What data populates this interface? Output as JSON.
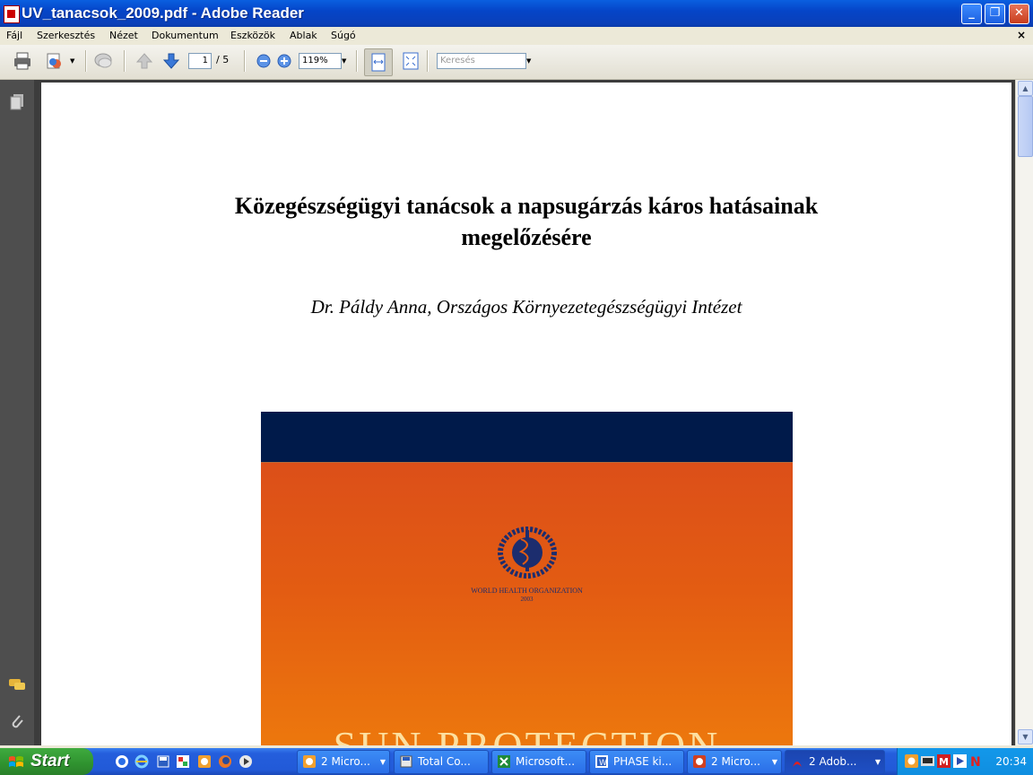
{
  "window": {
    "title": "UV_tanacsok_2009.pdf - Adobe Reader",
    "buttons": {
      "minimize": "_",
      "maximize": "❐",
      "close": "✕"
    }
  },
  "menu": {
    "items": [
      "Fájl",
      "Szerkesztés",
      "Nézet",
      "Dokumentum",
      "Eszközök",
      "Ablak",
      "Súgó"
    ],
    "doc_close": "×"
  },
  "toolbar": {
    "page_current": "1",
    "page_total": "/ 5",
    "zoom": "119%",
    "search_placeholder": "Keresés"
  },
  "document": {
    "title_line1": "Közegészségügyi tanácsok a napsugárzás káros hatásainak",
    "title_line2": "megelőzésére",
    "author": "Dr. Páldy Anna, Országos Környezetegészségügyi Intézet",
    "cover": {
      "org": "WORLD HEALTH ORGANIZATION",
      "year": "2003",
      "big_title": "SUN PROTECTION"
    }
  },
  "taskbar": {
    "start_label": "Start",
    "tasks": [
      {
        "label": "2 Micro...",
        "icon": "clock-app-icon",
        "dropdown": true
      },
      {
        "label": "Total Co...",
        "icon": "floppy-icon",
        "dropdown": false
      },
      {
        "label": "Microsoft...",
        "icon": "excel-icon",
        "dropdown": false
      },
      {
        "label": "PHASE ki...",
        "icon": "word-icon",
        "dropdown": false
      },
      {
        "label": "2 Micro...",
        "icon": "powerpoint-icon",
        "dropdown": true
      },
      {
        "label": "2 Adob...",
        "icon": "adobe-icon",
        "dropdown": true
      }
    ],
    "clock": "20:34"
  }
}
